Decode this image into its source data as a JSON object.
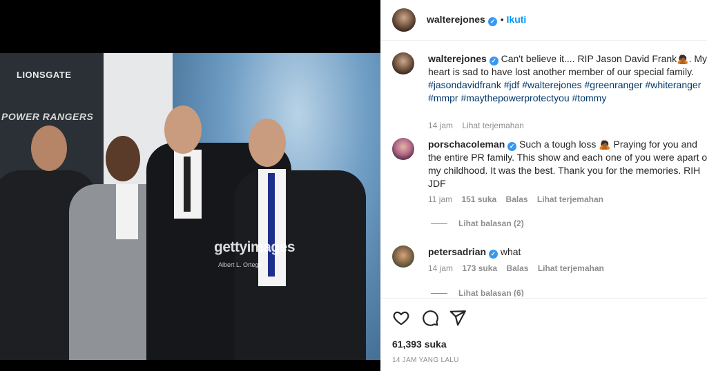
{
  "post": {
    "photo": {
      "brand_top": "LIONSGATE",
      "brand_title": "POWER RANGERS",
      "watermark": "gettyimages",
      "watermark_credit": "Albert L. Ortega"
    },
    "author": {
      "username": "walterejones",
      "follow_label": "Ikuti",
      "avatar_icon": "profile-photo"
    },
    "caption": {
      "username": "walterejones",
      "text": "Can't believe it.... RIP Jason David Frank🙇🏾. My heart is sad to have lost another member of our special family.",
      "hashtags_line1": "#jasondavidfrank #jdf #walterejones #greenranger #whiteranger",
      "hashtags_line2": "#mmpr #maythepowerprotectyou #tommy",
      "time": "14 jam",
      "translate": "Lihat terjemahan"
    },
    "comments": [
      {
        "username": "porschacoleman",
        "text": "Such a tough loss 🙇🏾 Praying for you and the entire PR family. This show and each one of you were apart of my childhood. It was the best. Thank you for the memories. RIH JDF",
        "time": "11 jam",
        "likes": "151 suka",
        "reply": "Balas",
        "translate": "Lihat terjemahan",
        "view_replies": "Lihat balasan (2)"
      },
      {
        "username": "petersadrian",
        "text": "what",
        "time": "14 jam",
        "likes": "173 suka",
        "reply": "Balas",
        "translate": "Lihat terjemahan",
        "view_replies": "Lihat balasan (6)"
      }
    ],
    "likes_count": "61,393 suka",
    "posted_ago": "14 JAM YANG LALU"
  },
  "colors": {
    "link": "#0095f6",
    "hashtag": "#00376b",
    "verified": "#3897f0",
    "muted": "#8e8e8e"
  }
}
